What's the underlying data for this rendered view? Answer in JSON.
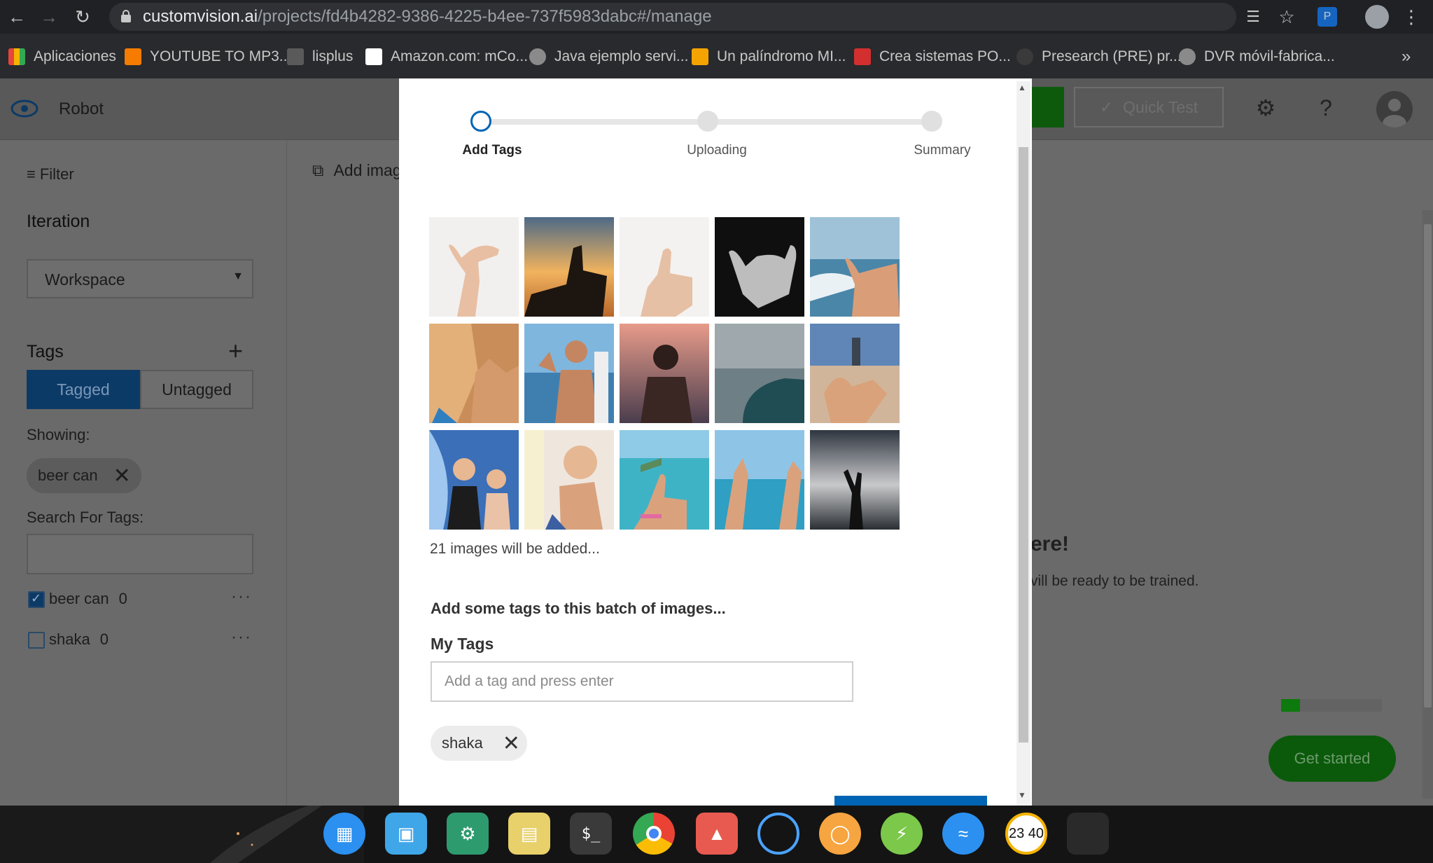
{
  "browser": {
    "url_host": "customvision.ai",
    "url_path": "/projects/fd4b4282-9386-4225-b4ee-737f5983dabc#/manage"
  },
  "bookmarks": [
    {
      "label": "Aplicaciones",
      "color": "#e8453c"
    },
    {
      "label": "YOUTUBE TO MP3...",
      "color": "#f57c00"
    },
    {
      "label": "lisplus",
      "color": "#9e9e9e"
    },
    {
      "label": "Amazon.com: mCo...",
      "color": "#ffffff"
    },
    {
      "label": "Java ejemplo servi...",
      "color": "#9e9e9e"
    },
    {
      "label": "Un palíndromo MI...",
      "color": "#f4a300"
    },
    {
      "label": "Crea sistemas PO...",
      "color": "#d32f2f"
    },
    {
      "label": "Presearch (PRE) pr...",
      "color": "#3a3a3a"
    },
    {
      "label": "DVR móvil-fabrica...",
      "color": "#9e9e9e"
    }
  ],
  "header": {
    "project_name": "Robot",
    "quick_test_label": "Quick Test"
  },
  "sidebar": {
    "filter_label": "Filter",
    "iteration_heading": "Iteration",
    "iteration_value": "Workspace",
    "tags_heading": "Tags",
    "tab_tagged": "Tagged",
    "tab_untagged": "Untagged",
    "showing_label": "Showing:",
    "showing_chip": "beer can",
    "search_label": "Search For Tags:",
    "tags": [
      {
        "name": "beer can",
        "count": "0",
        "checked": true
      },
      {
        "name": "shaka",
        "count": "0",
        "checked": false
      }
    ]
  },
  "main": {
    "add_images_label": "Add imag",
    "heading_partial": "ere!",
    "subtext_partial": "vill be ready to be trained.",
    "get_started_label": "Get started",
    "progress_fraction": 0.19
  },
  "modal": {
    "steps": [
      {
        "label": "Add Tags",
        "active": true
      },
      {
        "label": "Uploading",
        "active": false
      },
      {
        "label": "Summary",
        "active": false
      }
    ],
    "images_count_text": "21 images will be added...",
    "prompt_text": "Add some tags to this batch of images...",
    "my_tags_label": "My Tags",
    "tag_input_placeholder": "Add a tag and press enter",
    "added_tag": "shaka"
  },
  "taskbar": {
    "clock": "23 40"
  }
}
